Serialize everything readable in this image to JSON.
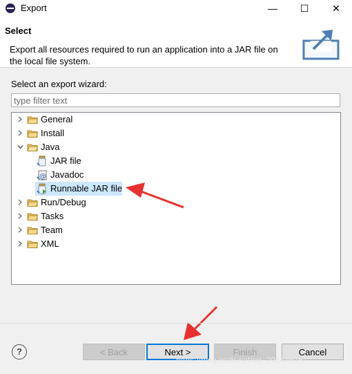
{
  "window": {
    "title": "Export",
    "minimize": "—",
    "maximize": "☐",
    "close": "✕"
  },
  "header": {
    "title": "Select",
    "description": "Export all resources required to run an application into a JAR file on the local file system."
  },
  "wizard_label": "Select an export wizard:",
  "filter": {
    "placeholder": "type filter text",
    "value": ""
  },
  "tree": {
    "items": [
      {
        "label": "General",
        "expanded": false
      },
      {
        "label": "Install",
        "expanded": false
      },
      {
        "label": "Java",
        "expanded": true,
        "children": [
          {
            "label": "JAR file",
            "icon": "jar-icon"
          },
          {
            "label": "Javadoc",
            "icon": "javadoc-icon"
          },
          {
            "label": "Runnable JAR file",
            "icon": "runnable-jar-icon",
            "selected": true
          }
        ]
      },
      {
        "label": "Run/Debug",
        "expanded": false
      },
      {
        "label": "Tasks",
        "expanded": false
      },
      {
        "label": "Team",
        "expanded": false
      },
      {
        "label": "XML",
        "expanded": false
      }
    ]
  },
  "buttons": {
    "help": "?",
    "back": "< Back",
    "next": "Next >",
    "finish": "Finish",
    "cancel": "Cancel"
  },
  "watermark": "https://blog.csdn.net/qq_29144615",
  "colors": {
    "selection": "#cce8ff",
    "default_button_border": "#0078d7",
    "annotation_arrow": "#e8312e"
  }
}
